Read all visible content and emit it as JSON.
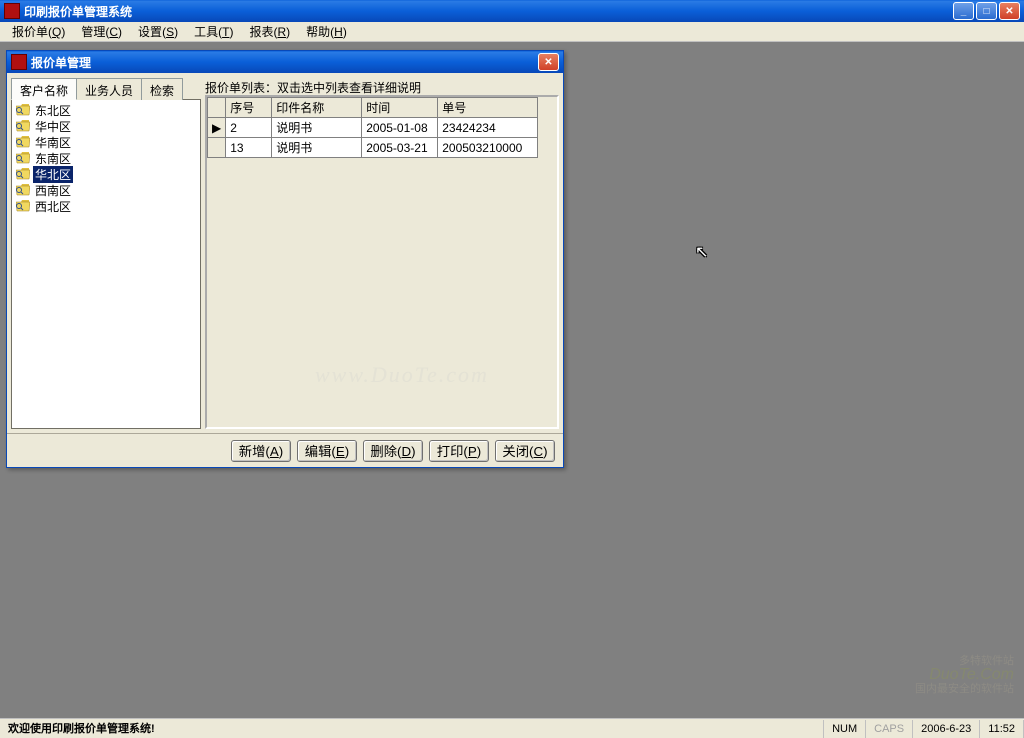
{
  "app": {
    "title": "印刷报价单管理系统"
  },
  "menu": {
    "items": [
      {
        "label": "报价单",
        "mnemonic": "Q"
      },
      {
        "label": "管理",
        "mnemonic": "C"
      },
      {
        "label": "设置",
        "mnemonic": "S"
      },
      {
        "label": "工具",
        "mnemonic": "T"
      },
      {
        "label": "报表",
        "mnemonic": "R"
      },
      {
        "label": "帮助",
        "mnemonic": "H"
      }
    ]
  },
  "dialog": {
    "title": "报价单管理",
    "tabs": {
      "customer": "客户名称",
      "staff": "业务人员",
      "search": "检索",
      "active": 0
    },
    "regions": [
      {
        "label": "东北区",
        "selected": false
      },
      {
        "label": "华中区",
        "selected": false
      },
      {
        "label": "华南区",
        "selected": false
      },
      {
        "label": "东南区",
        "selected": false
      },
      {
        "label": "华北区",
        "selected": true
      },
      {
        "label": "西南区",
        "selected": false
      },
      {
        "label": "西北区",
        "selected": false
      }
    ],
    "list_caption": "报价单列表：双击选中列表查看详细说明",
    "columns": {
      "serial": "序号",
      "item_name": "印件名称",
      "time": "时间",
      "code": "单号"
    },
    "rows": [
      {
        "indicator": "▶",
        "serial": "2",
        "item_name": "说明书",
        "time": "2005-01-08",
        "code": "23424234"
      },
      {
        "indicator": " ",
        "serial": "13",
        "item_name": "说明书",
        "time": "2005-03-21",
        "code": "200503210000"
      }
    ],
    "buttons": {
      "add": {
        "label": "新增",
        "mnemonic": "A"
      },
      "edit": {
        "label": "编辑",
        "mnemonic": "E"
      },
      "delete": {
        "label": "删除",
        "mnemonic": "D"
      },
      "print": {
        "label": "打印",
        "mnemonic": "P"
      },
      "close": {
        "label": "关闭",
        "mnemonic": "C"
      }
    }
  },
  "statusbar": {
    "welcome": "欢迎使用印刷报价单管理系统!",
    "num": "NUM",
    "caps": "CAPS",
    "date": "2006-6-23",
    "time": "11:52"
  },
  "watermark": "www.DuoTe.com",
  "bottom_brand": {
    "cn": "多特软件站",
    "en": "DuoTe.Com",
    "tag": "国内最安全的软件站"
  }
}
